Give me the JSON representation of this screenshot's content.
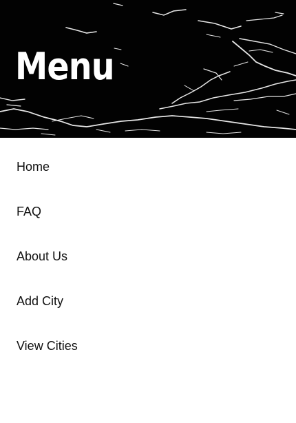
{
  "header": {
    "title": "Menu",
    "background_color": "#020202",
    "title_color": "#ffffff"
  },
  "menu": {
    "items": [
      {
        "label": "Home"
      },
      {
        "label": "FAQ"
      },
      {
        "label": "About Us"
      },
      {
        "label": "Add City"
      },
      {
        "label": "View Cities"
      }
    ]
  },
  "colors": {
    "text": "#111111",
    "background": "#ffffff"
  }
}
